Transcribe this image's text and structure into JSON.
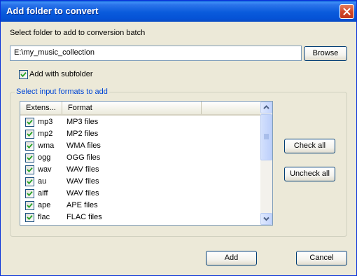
{
  "window": {
    "title": "Add folder to convert"
  },
  "folder_section": {
    "label": "Select folder to add to conversion batch",
    "path_value": "E:\\my_music_collection",
    "browse_label": "Browse",
    "subfolder_label": "Add with subfolder",
    "subfolder_checked": true
  },
  "formats_group": {
    "legend": "Select input formats to add",
    "columns": [
      "Extens...",
      "Format"
    ],
    "rows": [
      {
        "ext": "mp3",
        "format": "MP3 files",
        "checked": true
      },
      {
        "ext": "mp2",
        "format": "MP2 files",
        "checked": true
      },
      {
        "ext": "wma",
        "format": "WMA files",
        "checked": true
      },
      {
        "ext": "ogg",
        "format": "OGG files",
        "checked": true
      },
      {
        "ext": "wav",
        "format": "WAV files",
        "checked": true
      },
      {
        "ext": "au",
        "format": "WAV files",
        "checked": true
      },
      {
        "ext": "aiff",
        "format": "WAV files",
        "checked": true
      },
      {
        "ext": "ape",
        "format": "APE files",
        "checked": true
      },
      {
        "ext": "flac",
        "format": "FLAC files",
        "checked": true
      }
    ],
    "check_all_label": "Check all",
    "uncheck_all_label": "Uncheck all"
  },
  "footer": {
    "add_label": "Add",
    "cancel_label": "Cancel"
  },
  "colors": {
    "title_bar": "#0a5bdc",
    "group_legend": "#0046d5",
    "check_mark": "#21a121"
  },
  "icons": {
    "close": "close-icon",
    "check": "check-mark-icon",
    "scroll_up": "chevron-up-icon",
    "scroll_down": "chevron-down-icon"
  }
}
